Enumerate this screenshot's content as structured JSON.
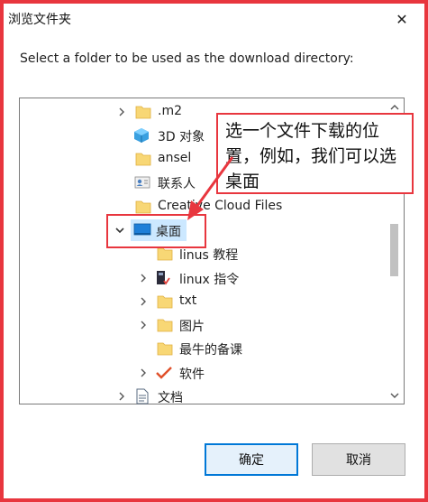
{
  "window": {
    "title": "浏览文件夹",
    "close_label": "✕"
  },
  "instruction": "Select a folder to be used as the download directory:",
  "tree": {
    "items": [
      {
        "label": ".m2",
        "icon": "folder-icon",
        "expandable": true
      },
      {
        "label": "3D 对象",
        "icon": "3d-objects-icon",
        "expandable": false
      },
      {
        "label": "ansel",
        "icon": "folder-icon",
        "expandable": false
      },
      {
        "label": "联系人",
        "icon": "contacts-icon",
        "expandable": false
      },
      {
        "label": "Creative Cloud Files",
        "icon": "folder-icon",
        "expandable": false
      },
      {
        "label": "桌面",
        "icon": "desktop-icon",
        "expandable": true,
        "expanded": true,
        "selected": true
      },
      {
        "label": "linus 教程",
        "icon": "folder-icon",
        "expandable": false
      },
      {
        "label": "linux 指令",
        "icon": "linux-folder-icon",
        "expandable": true
      },
      {
        "label": "txt",
        "icon": "folder-icon",
        "expandable": true
      },
      {
        "label": "图片",
        "icon": "folder-icon",
        "expandable": true
      },
      {
        "label": "最牛的备课",
        "icon": "folder-icon",
        "expandable": false
      },
      {
        "label": "软件",
        "icon": "checkmark-icon",
        "expandable": true
      },
      {
        "label": "文档",
        "icon": "document-icon",
        "expandable": true
      }
    ]
  },
  "annotation": {
    "text": "选一个文件下载的位置，例如，我们可以选桌面"
  },
  "buttons": {
    "ok_label": "确定",
    "cancel_label": "取消"
  },
  "colors": {
    "accent": "#0078d7",
    "annotation_red": "#e8363e",
    "folder_yellow": "#f8d775",
    "selection": "#cce8ff"
  }
}
